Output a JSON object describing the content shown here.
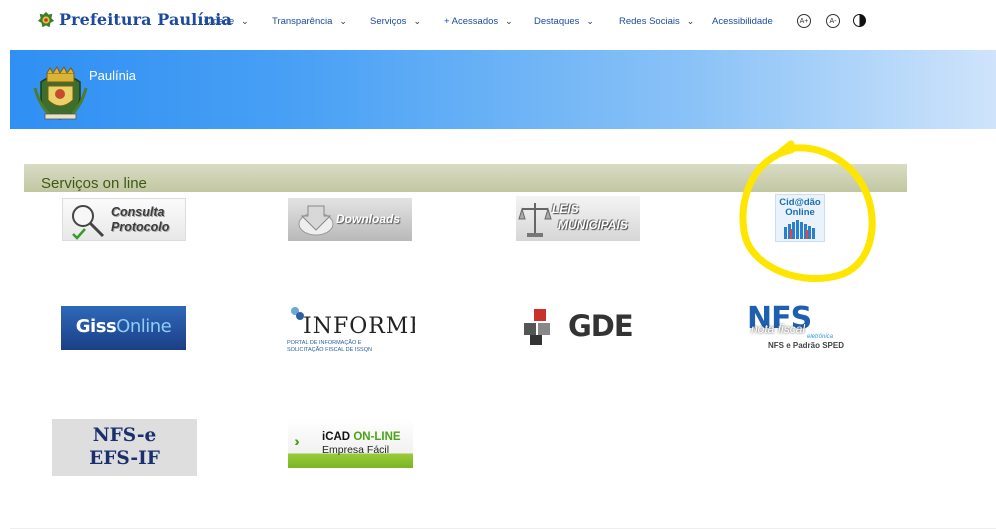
{
  "brand": {
    "name": "Prefeitura Paulínia"
  },
  "nav": {
    "items": [
      {
        "label": "Cidade",
        "chevron": "⌄"
      },
      {
        "label": "Transparência",
        "chevron": "⌄"
      },
      {
        "label": "Serviços",
        "chevron": "⌄"
      },
      {
        "label": "+ Acessados",
        "chevron": "⌄"
      },
      {
        "label": "Destaques",
        "chevron": "⌄"
      },
      {
        "label": "Redes Sociais",
        "chevron": "⌄"
      },
      {
        "label": "Acessibilidade"
      }
    ],
    "font_increase": "A+",
    "font_decrease": "A-"
  },
  "banner": {
    "title": "Paulínia"
  },
  "section": {
    "title": "Serviços on line"
  },
  "tiles": {
    "consulta": {
      "line1": "Consulta",
      "line2": "Protocolo"
    },
    "downloads": {
      "label": "Downloads"
    },
    "leis": {
      "line1": "LEIS",
      "line2": "MUNICIPAIS"
    },
    "cidadao": {
      "line1": "Cid@dão",
      "line2": "Online"
    },
    "giss": {
      "part1": "Giss",
      "part2": "Online"
    },
    "informe": {
      "title": "INFORME",
      "sub1": "PORTAL DE INFORMAÇÃO E",
      "sub2": "SOLICITAÇÃO FISCAL DE ISSQN"
    },
    "gde": {
      "label": "GDE"
    },
    "nfs": {
      "big": "NFS",
      "nota": "nota fiscal",
      "eletronica": "eletrônica",
      "padrao": "NFS  e Padrão SPED"
    },
    "nfse": {
      "line1": "NFS-e",
      "line2": "EFS-IF"
    },
    "icad": {
      "part1": "iCAD",
      "part2": "ON-LINE",
      "line2": "Empresa Fácil"
    }
  },
  "colors": {
    "brand_blue": "#1d4aa0",
    "highlight": "#ffe600",
    "section_text": "#3d5a12"
  }
}
